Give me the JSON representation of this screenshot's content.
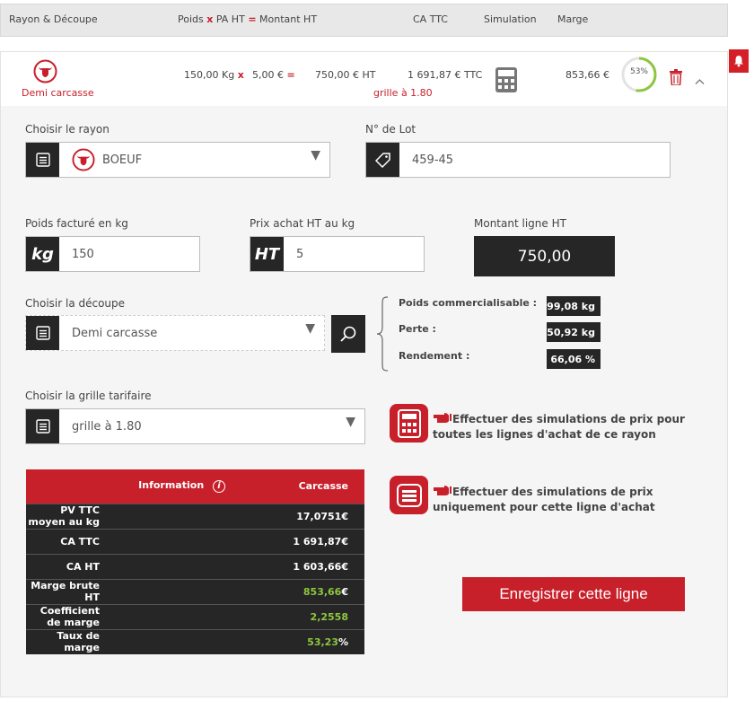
{
  "header": {
    "col_rayon": "Rayon & Découpe",
    "col_poids": "Poids",
    "col_x": "x",
    "col_pa": "PA HT",
    "col_eq": "=",
    "col_montant": "Montant HT",
    "col_ca": "CA TTC",
    "col_simulation": "Simulation",
    "col_marge": "Marge"
  },
  "summary": {
    "decoupe": "Demi carcasse",
    "poids": "150,00 Kg",
    "x": "x",
    "pa": "5,00 €",
    "eq": "=",
    "montant": "750,00 € HT",
    "ca_ttc": "1 691,87 € TTC",
    "grille": "grille à 1.80",
    "marge": "853,66 €",
    "progress_label": "53%",
    "progress_value": 53
  },
  "form": {
    "rayon_label": "Choisir le rayon",
    "rayon_value": "BOEUF",
    "lot_label": "N° de Lot",
    "lot_value": "459-45",
    "poids_label": "Poids facturé en kg",
    "poids_prefix": "kg",
    "poids_value": "150",
    "prix_label": "Prix achat HT au kg",
    "prix_prefix": "HT",
    "prix_value": "5",
    "montant_label": "Montant ligne HT",
    "montant_value": "750,00",
    "decoupe_label": "Choisir la découpe",
    "decoupe_value": "Demi carcasse",
    "grille_label": "Choisir la grille tarifaire",
    "grille_value": "grille à 1.80"
  },
  "stats": {
    "poids_comm_label": "Poids commercialisable :",
    "poids_comm_value": "99,08 kg",
    "perte_label": "Perte :",
    "perte_value": "50,92 kg",
    "rendement_label": "Rendement :",
    "rendement_value": "66,06 %"
  },
  "simulation": {
    "all_text": "Effectuer des simulations de prix pour toutes les lignes d'achat de ce rayon",
    "one_text": "Effectuer des simulations de prix uniquement pour cette ligne d'achat"
  },
  "info_table": {
    "header_info": "Information",
    "header_carcasse": "Carcasse",
    "rows": [
      {
        "label": "PV TTC moyen au kg",
        "value": "17,0751€"
      },
      {
        "label": "CA TTC",
        "value": "1 691,87€"
      },
      {
        "label": "CA HT",
        "value": "1 603,66€"
      },
      {
        "label": "Marge brute HT",
        "value": "853,66",
        "suffix": "€"
      },
      {
        "label": "Coefficient de marge",
        "value": "2,2558",
        "suffix": ""
      },
      {
        "label": "Taux de marge",
        "value": "53,23",
        "suffix": "%"
      }
    ]
  },
  "save_label": "Enregistrer cette ligne",
  "colors": {
    "accent": "#c8202a",
    "dark": "#262626",
    "green": "#8ec63f"
  }
}
